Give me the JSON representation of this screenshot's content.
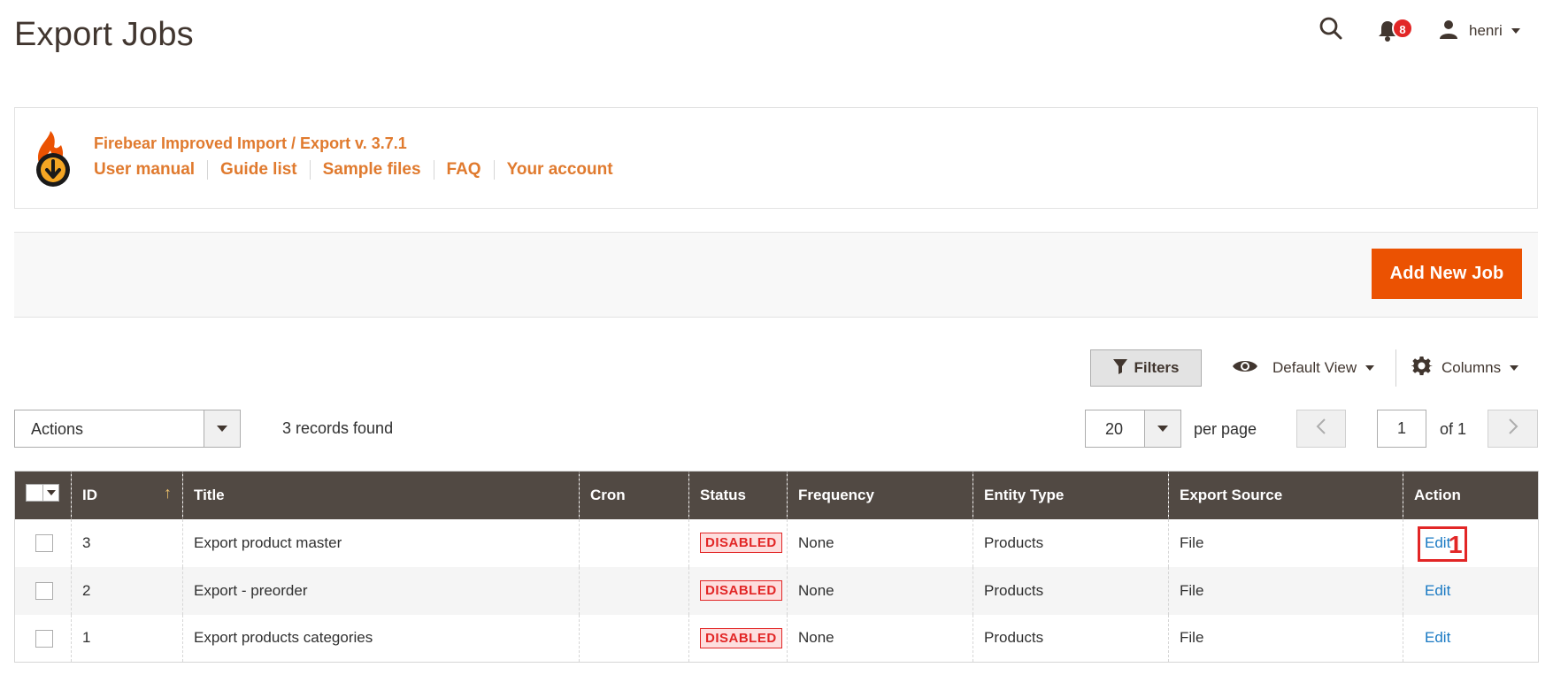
{
  "page": {
    "title": "Export Jobs"
  },
  "header": {
    "notification_count": "8",
    "user_name": "henri"
  },
  "extension": {
    "title": "Firebear Improved Import / Export v. 3.7.1",
    "links": [
      "User manual",
      "Guide list",
      "Sample files",
      "FAQ",
      "Your account"
    ]
  },
  "action_bar": {
    "add_button": "Add New Job"
  },
  "toolbar": {
    "filters": "Filters",
    "view": "Default View",
    "columns": "Columns",
    "actions": "Actions",
    "records_found": "3 records found",
    "per_page_value": "20",
    "per_page_label": "per page",
    "page_value": "1",
    "of_pages": "of 1"
  },
  "grid": {
    "columns": [
      "ID",
      "Title",
      "Cron",
      "Status",
      "Frequency",
      "Entity Type",
      "Export Source",
      "Action"
    ],
    "rows": [
      {
        "id": "3",
        "title": "Export product master",
        "cron": "",
        "status": "DISABLED",
        "frequency": "None",
        "entity_type": "Products",
        "export_source": "File",
        "action": "Edit"
      },
      {
        "id": "2",
        "title": "Export - preorder",
        "cron": "",
        "status": "DISABLED",
        "frequency": "None",
        "entity_type": "Products",
        "export_source": "File",
        "action": "Edit"
      },
      {
        "id": "1",
        "title": "Export products categories",
        "cron": "",
        "status": "DISABLED",
        "frequency": "None",
        "entity_type": "Products",
        "export_source": "File",
        "action": "Edit"
      }
    ]
  },
  "annotation": {
    "step_number": "1"
  },
  "colors": {
    "accent": "#eb5202",
    "link_orange": "#e07a2e",
    "header_bg": "#514943",
    "status_red": "#e22626",
    "link_blue": "#1979c3"
  },
  "icons": [
    "search-icon",
    "bell-icon",
    "user-icon",
    "filter-icon",
    "eye-icon",
    "gear-icon",
    "chevron-left-icon",
    "chevron-right-icon",
    "firebear-logo"
  ]
}
